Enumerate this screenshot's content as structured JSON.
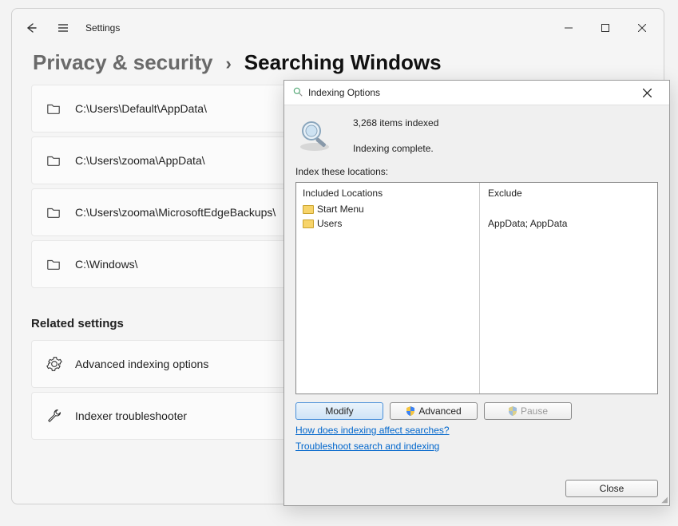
{
  "app": {
    "title": "Settings"
  },
  "breadcrumb": {
    "parent": "Privacy & security",
    "separator": "›",
    "current": "Searching Windows"
  },
  "paths": [
    "C:\\Users\\Default\\AppData\\",
    "C:\\Users\\zooma\\AppData\\",
    "C:\\Users\\zooma\\MicrosoftEdgeBackups\\",
    "C:\\Windows\\"
  ],
  "related": {
    "heading": "Related settings",
    "items": [
      "Advanced indexing options",
      "Indexer troubleshooter"
    ]
  },
  "dialog": {
    "title": "Indexing Options",
    "items_indexed": "3,268 items indexed",
    "status": "Indexing complete.",
    "index_label": "Index these locations:",
    "columns": {
      "included": "Included Locations",
      "exclude": "Exclude"
    },
    "included": [
      "Start Menu",
      "Users"
    ],
    "exclude": [
      "AppData; AppData"
    ],
    "buttons": {
      "modify": "Modify",
      "advanced": "Advanced",
      "pause": "Pause",
      "close": "Close"
    },
    "links": {
      "how": "How does indexing affect searches?",
      "troubleshoot": "Troubleshoot search and indexing"
    }
  }
}
